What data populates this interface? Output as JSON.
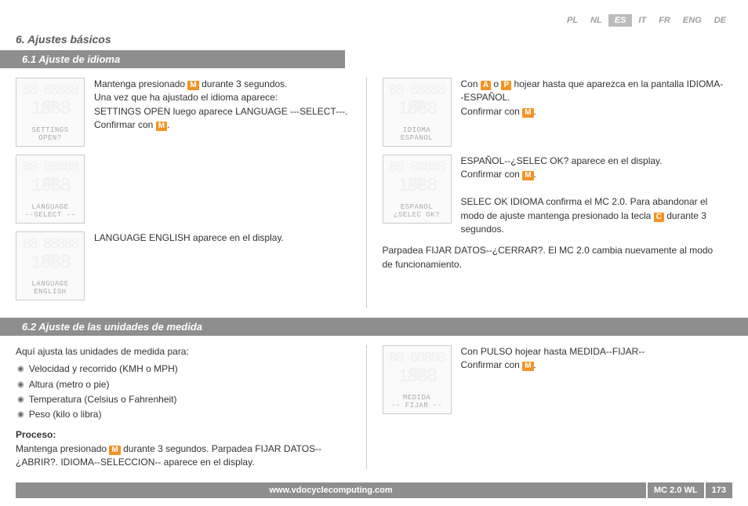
{
  "langs": [
    "PL",
    "NL",
    "ES",
    "IT",
    "FR",
    "ENG",
    "DE"
  ],
  "active_lang": "ES",
  "section_title": "6.  Ajustes básicos",
  "h61": "6.1 Ajuste de idioma",
  "h62": "6.2 Ajuste de las unidades de medida",
  "thumbs": {
    "settings": "SETTINGS\nOPEN?",
    "lang_select": "LANGUAGE\n--SELECT --",
    "lang_english": "LANGUAGE\nENGLISH",
    "idioma": "IDIOMA\nESPANOL",
    "espanol_ok": "ESPANOL\n¿SELEC OK?",
    "medida": "MEDIDA\n-- FIJAR --"
  },
  "chips": {
    "M": "M",
    "A": "A",
    "P": "P",
    "C": "C"
  },
  "col1": {
    "p1a": "Mantenga presionado ",
    "p1b": " durante 3 segundos.",
    "p2": "Una vez que ha ajustado el idioma aparece:",
    "p3": "SETTINGS OPEN luego aparece LANGUAGE ---SELECT---.",
    "p4a": "Confirmar con ",
    "p4b": ".",
    "p5": "",
    "p6": "LANGUAGE ENGLISH aparece en el display."
  },
  "col2": {
    "p1a": "Con ",
    "p1b": " o ",
    "p1c": " hojear hasta que aparezca en la pantalla IDIOMA--ESPAÑOL.",
    "p2a": "Confirmar con ",
    "p2b": ".",
    "p3": "ESPAÑOL--¿SELEC OK? aparece en el display.",
    "p4a": "Confirmar con ",
    "p4b": ".",
    "p5a": "SELEC OK IDIOMA confirma el MC 2.0. Para abandonar el modo de ajuste mantenga presionado la tecla ",
    "p5b": " durante 3 segundos.",
    "p6": "Parpadea FIJAR DATOS--¿CERRAR?. El MC 2.0 cambia nuevamente al modo de funcionamiento."
  },
  "s62": {
    "intro": "Aquí ajusta las unidades de medida para:",
    "bullets": [
      "Velocidad y recorrido (KMH o MPH)",
      "Altura (metro o pie)",
      "Temperatura (Celsius o Fahrenheit)",
      "Peso (kilo o libra)"
    ],
    "proc_label": "Proceso:",
    "proc_a": "Mantenga presionado ",
    "proc_b": " durante 3 segundos. Parpadea FIJAR DATOS--¿ABRIR?. IDIOMA--SELECCION-- aparece en el display.",
    "right_a": "Con PULSO hojear hasta MEDIDA--FIJAR--",
    "right_b": "Confirmar con ",
    "right_c": "."
  },
  "footer": {
    "url": "www.vdocyclecomputing.com",
    "model": "MC 2.0 WL",
    "page": "173"
  }
}
